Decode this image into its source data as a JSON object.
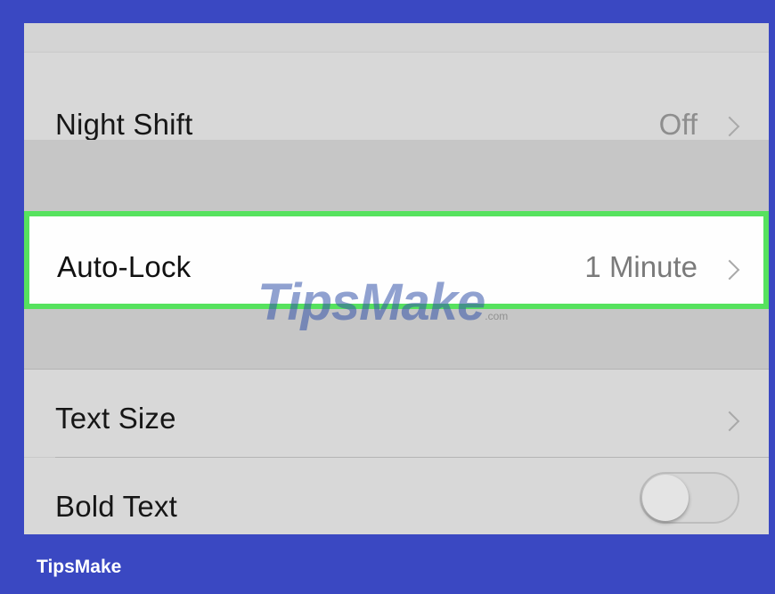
{
  "settings": {
    "rows": [
      {
        "label": "Night Shift",
        "value": "Off",
        "control": "chevron"
      },
      {
        "label": "Auto-Lock",
        "value": "1 Minute",
        "control": "chevron",
        "highlighted": true,
        "highlight_color": "#56e25e"
      },
      {
        "label": "Text Size",
        "value": "",
        "control": "chevron"
      },
      {
        "label": "Bold Text",
        "control": "toggle",
        "toggle_on": false
      }
    ]
  },
  "watermark": {
    "text": "TipsMake",
    "suffix": ".com"
  },
  "footer": {
    "brand": "TipsMake"
  },
  "colors": {
    "frame": "#3a48c2",
    "highlight": "#56e25e"
  }
}
